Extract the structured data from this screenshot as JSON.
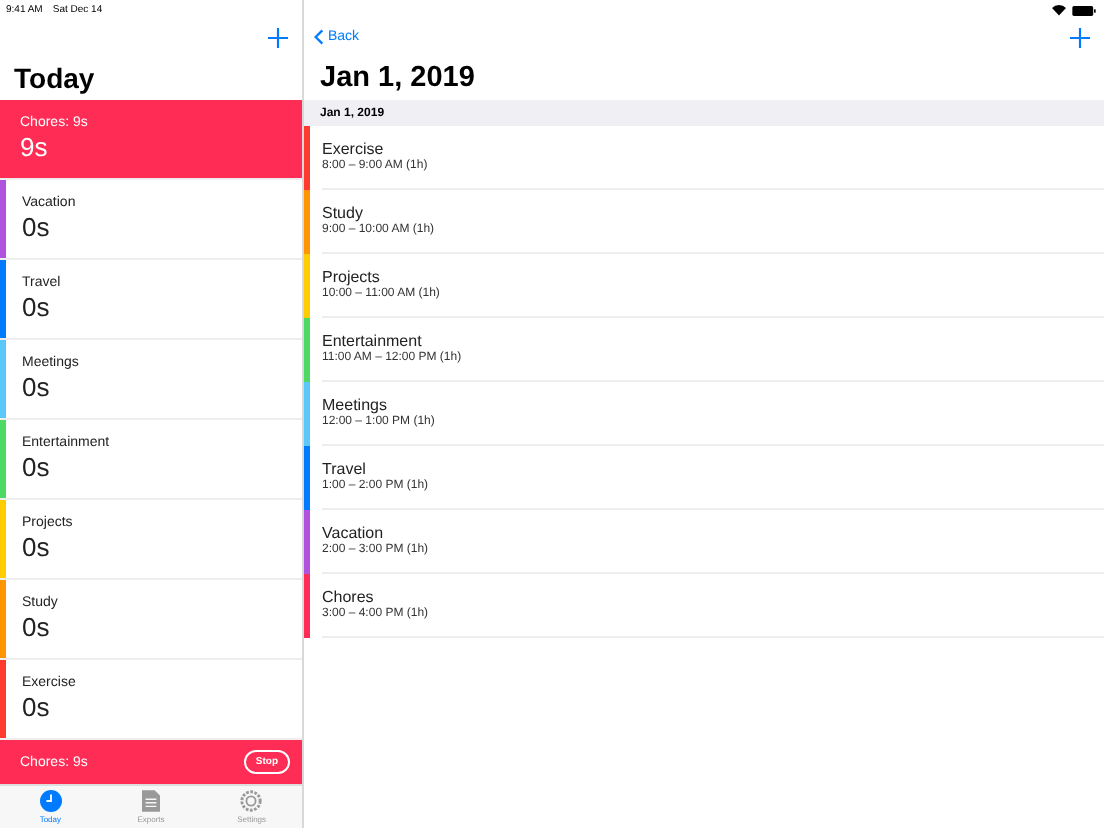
{
  "status_bar": {
    "time": "9:41 AM",
    "date": "Sat Dec 14"
  },
  "left": {
    "title": "Today",
    "items": [
      {
        "label": "Chores: 9s",
        "value": "9s",
        "color": "#ff2d55",
        "selected": true
      },
      {
        "label": "Vacation",
        "value": "0s",
        "color": "#af52de",
        "selected": false
      },
      {
        "label": "Travel",
        "value": "0s",
        "color": "#007aff",
        "selected": false
      },
      {
        "label": "Meetings",
        "value": "0s",
        "color": "#5ac8fa",
        "selected": false
      },
      {
        "label": "Entertainment",
        "value": "0s",
        "color": "#4cd964",
        "selected": false
      },
      {
        "label": "Projects",
        "value": "0s",
        "color": "#ffcc00",
        "selected": false
      },
      {
        "label": "Study",
        "value": "0s",
        "color": "#ff9500",
        "selected": false
      },
      {
        "label": "Exercise",
        "value": "0s",
        "color": "#ff3b30",
        "selected": false
      }
    ],
    "timer_bar": {
      "label": "Chores: 9s",
      "button": "Stop"
    }
  },
  "tabs": [
    {
      "label": "Today",
      "kind": "today",
      "selected": true
    },
    {
      "label": "Exports",
      "kind": "exports",
      "selected": false
    },
    {
      "label": "Settings",
      "kind": "settings",
      "selected": false
    }
  ],
  "right": {
    "back": "Back",
    "title": "Jan 1, 2019",
    "section": "Jan 1, 2019",
    "entries": [
      {
        "name": "Exercise",
        "time": "8:00 – 9:00 AM (1h)",
        "color": "#ff3b30"
      },
      {
        "name": "Study",
        "time": "9:00 – 10:00 AM (1h)",
        "color": "#ff9500"
      },
      {
        "name": "Projects",
        "time": "10:00 – 11:00 AM (1h)",
        "color": "#ffcc00"
      },
      {
        "name": "Entertainment",
        "time": "11:00 AM – 12:00 PM (1h)",
        "color": "#4cd964"
      },
      {
        "name": "Meetings",
        "time": "12:00 – 1:00 PM (1h)",
        "color": "#5ac8fa"
      },
      {
        "name": "Travel",
        "time": "1:00 – 2:00 PM (1h)",
        "color": "#007aff"
      },
      {
        "name": "Vacation",
        "time": "2:00 – 3:00 PM (1h)",
        "color": "#af52de"
      },
      {
        "name": "Chores",
        "time": "3:00 – 4:00 PM (1h)",
        "color": "#ff2d55"
      }
    ]
  }
}
